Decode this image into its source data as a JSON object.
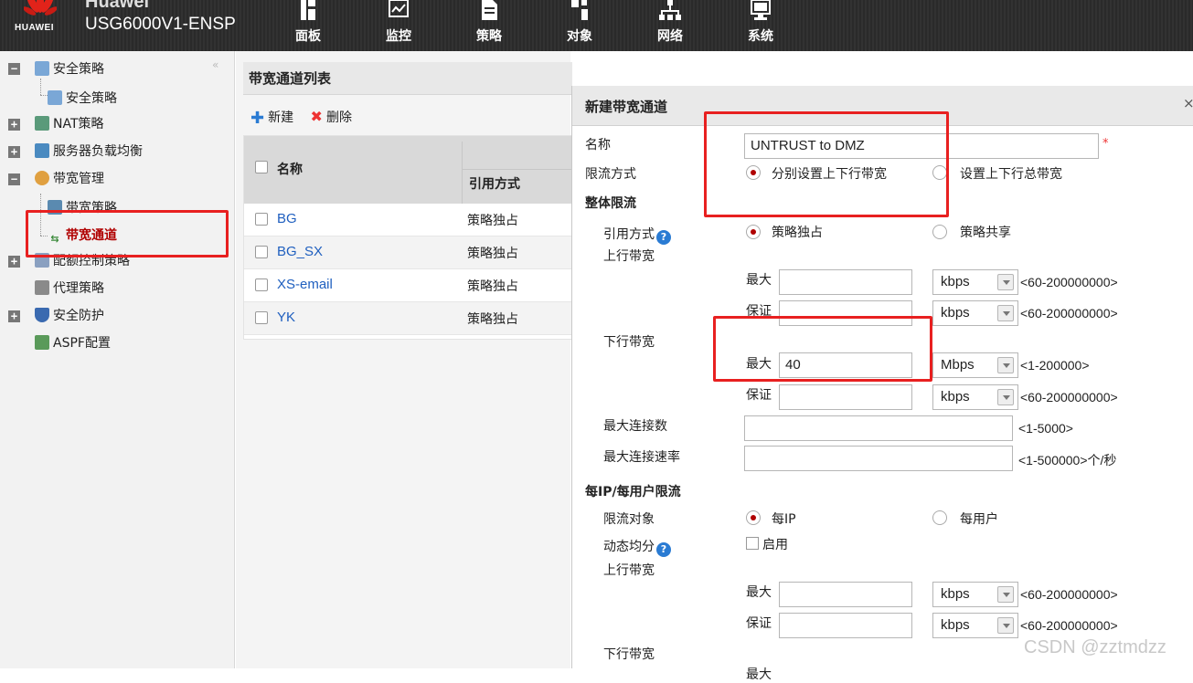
{
  "header": {
    "brand_line1": "Huawei",
    "brand_line2": "USG6000V1-ENSP",
    "logo_text": "HUAWEI",
    "nav": [
      {
        "label": "面板",
        "icon": "dashboard-icon"
      },
      {
        "label": "监控",
        "icon": "monitor-icon"
      },
      {
        "label": "策略",
        "icon": "policy-icon"
      },
      {
        "label": "对象",
        "icon": "object-icon"
      },
      {
        "label": "网络",
        "icon": "network-icon"
      },
      {
        "label": "系统",
        "icon": "system-icon"
      }
    ]
  },
  "sidebar": {
    "collapse_glyph": "«",
    "items": [
      {
        "label": "安全策略",
        "toggle": "−"
      },
      {
        "label": "安全策略"
      },
      {
        "label": "NAT策略",
        "toggle": "+"
      },
      {
        "label": "服务器负载均衡",
        "toggle": "+"
      },
      {
        "label": "带宽管理",
        "toggle": "−"
      },
      {
        "label": "带宽策略"
      },
      {
        "label": "带宽通道",
        "selected": true
      },
      {
        "label": "配额控制策略",
        "toggle": "+"
      },
      {
        "label": "代理策略"
      },
      {
        "label": "安全防护",
        "toggle": "+"
      },
      {
        "label": "ASPF配置"
      }
    ]
  },
  "list": {
    "title": "带宽通道列表",
    "toolbar": {
      "new_label": "新建",
      "delete_label": "删除"
    },
    "columns": [
      "名称",
      "引用方式"
    ],
    "rows": [
      {
        "name": "BG",
        "mode": "策略独占"
      },
      {
        "name": "BG_SX",
        "mode": "策略独占"
      },
      {
        "name": "XS-email",
        "mode": "策略独占"
      },
      {
        "name": "YK",
        "mode": "策略独占"
      }
    ]
  },
  "dialog": {
    "title": "新建带宽通道",
    "close": "×",
    "name_label": "名称",
    "name_value": "UNTRUST to DMZ",
    "required_mark": "*",
    "limit_mode_label": "限流方式",
    "limit_mode_opt1": "分别设置上下行带宽",
    "limit_mode_opt2": "设置上下行总带宽",
    "overall_section": "整体限流",
    "ref_mode_label": "引用方式",
    "ref_opt1": "策略独占",
    "ref_opt2": "策略共享",
    "up_bw_label": "上行带宽",
    "down_bw_label": "下行带宽",
    "max_label": "最大",
    "guar_label": "保证",
    "up_max": {
      "value": "",
      "unit": "kbps",
      "range": "<60-200000000>"
    },
    "up_guar": {
      "value": "",
      "unit": "kbps",
      "range": "<60-200000000>"
    },
    "down_max": {
      "value": "40",
      "unit": "Mbps",
      "range": "<1-200000>"
    },
    "down_guar": {
      "value": "",
      "unit": "kbps",
      "range": "<60-200000000>"
    },
    "max_conn_label": "最大连接数",
    "max_conn_range": "<1-5000>",
    "max_conn_rate_label": "最大连接速率",
    "max_conn_rate_range": "<1-500000>个/秒",
    "perip_section": "每IP/每用户限流",
    "limit_obj_label": "限流对象",
    "limit_obj_opt1": "每IP",
    "limit_obj_opt2": "每用户",
    "dyn_share_label": "动态均分",
    "enable_label": "启用",
    "up_bw2_label": "上行带宽",
    "down_bw2_label": "下行带宽",
    "up2_max": {
      "value": "",
      "unit": "kbps",
      "range": "<60-200000000>"
    },
    "up2_guar": {
      "value": "",
      "unit": "kbps",
      "range": "<60-200000000>"
    },
    "down2_max_label": "最大"
  },
  "watermark": "CSDN @zztmdzz",
  "colors": {
    "accent_red": "#b00000",
    "annotation_red": "#e82020",
    "link_blue": "#1f5fbf"
  }
}
